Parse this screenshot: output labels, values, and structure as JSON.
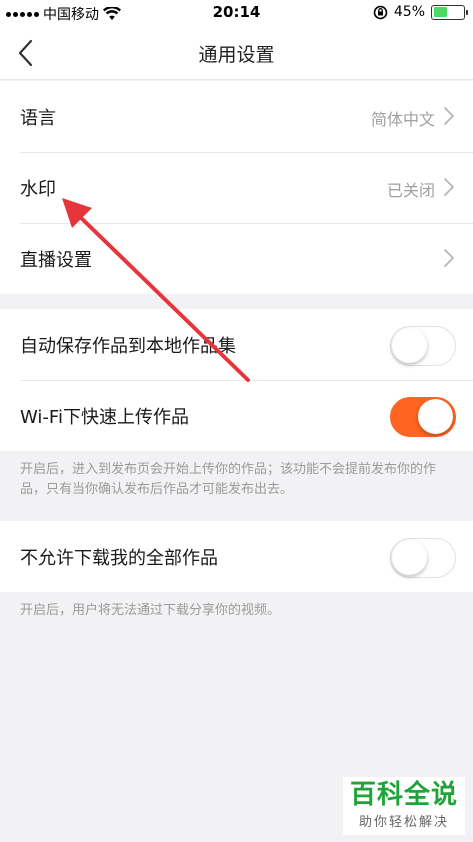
{
  "status_bar": {
    "carrier": "中国移动",
    "time": "20:14",
    "battery_percent": "45%",
    "battery_level": 0.45
  },
  "nav": {
    "title": "通用设置"
  },
  "group1": [
    {
      "label": "语言",
      "value": "简体中文"
    },
    {
      "label": "水印",
      "value": "已关闭"
    },
    {
      "label": "直播设置",
      "value": ""
    }
  ],
  "group2": {
    "auto_save": {
      "label": "自动保存作品到本地作品集",
      "on": false
    },
    "wifi_upload": {
      "label": "Wi-Fi下快速上传作品",
      "on": true
    },
    "hint": "开启后，进入到发布页会开始上传你的作品；该功能不会提前发布你的作品，只有当你确认发布后作品才可能发布出去。"
  },
  "group3": {
    "no_download": {
      "label": "不允许下载我的全部作品",
      "on": false
    },
    "hint": "开启后，用户将无法通过下载分享你的视频。"
  },
  "watermark": {
    "title": "百科全说",
    "subtitle": "助你轻松解决"
  },
  "colors": {
    "accent": "#ff6420",
    "annotation_arrow": "#e5363c",
    "brand_green": "#22a33a"
  }
}
